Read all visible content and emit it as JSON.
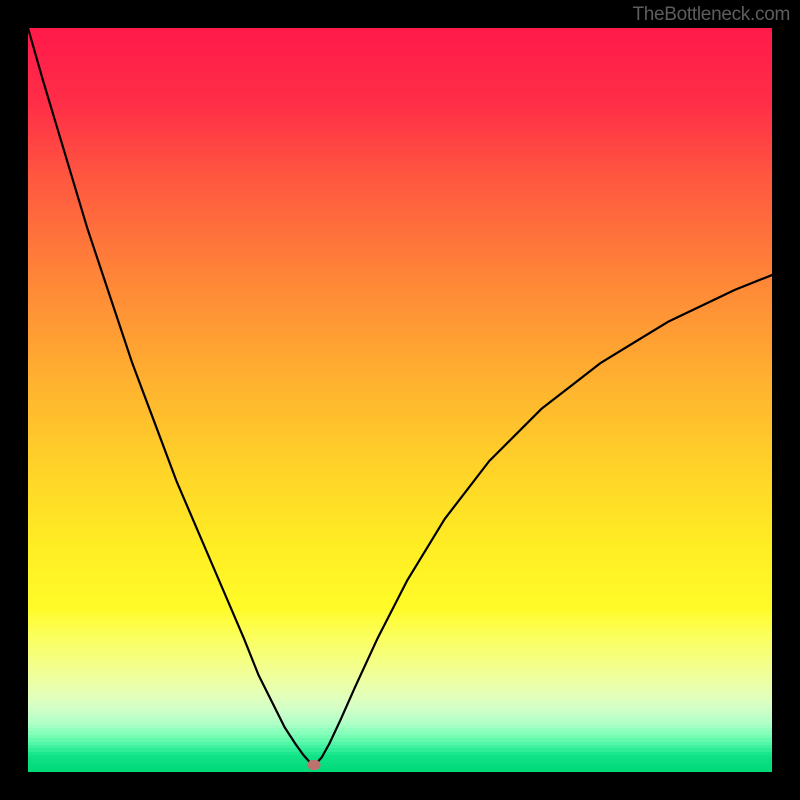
{
  "watermark": "TheBottleneck.com",
  "chart_data": {
    "type": "line",
    "title": "",
    "xlabel": "",
    "ylabel": "",
    "xlim": [
      0,
      100
    ],
    "ylim": [
      0,
      100
    ],
    "grid": false,
    "legend": false,
    "background": {
      "type": "vertical-gradient",
      "stops": [
        {
          "y": 0,
          "color": "#ff1a4a"
        },
        {
          "y": 10,
          "color": "#ff2e47"
        },
        {
          "y": 20,
          "color": "#ff5740"
        },
        {
          "y": 30,
          "color": "#ff7a3a"
        },
        {
          "y": 40,
          "color": "#ff9a34"
        },
        {
          "y": 50,
          "color": "#ffb92e"
        },
        {
          "y": 60,
          "color": "#ffd528"
        },
        {
          "y": 70,
          "color": "#ffee24"
        },
        {
          "y": 78,
          "color": "#fffb28"
        },
        {
          "y": 82,
          "color": "#fbff5e"
        },
        {
          "y": 86,
          "color": "#f3ff8c"
        },
        {
          "y": 89,
          "color": "#e9ffb0"
        },
        {
          "y": 91.5,
          "color": "#d5ffc8"
        },
        {
          "y": 93.5,
          "color": "#b2ffc8"
        },
        {
          "y": 95,
          "color": "#84ffba"
        },
        {
          "y": 96.3,
          "color": "#55f7a9"
        },
        {
          "y": 97.3,
          "color": "#2cec96"
        },
        {
          "y": 98,
          "color": "#11e388"
        },
        {
          "y": 100,
          "color": "#00da78"
        }
      ]
    },
    "series": [
      {
        "name": "bottleneck-curve",
        "x": [
          0,
          2,
          5,
          8,
          11,
          14,
          17,
          20,
          23,
          26,
          29,
          31,
          33,
          34.5,
          36,
          37,
          37.8,
          38.2,
          38.5,
          38.8,
          39.5,
          40.5,
          42,
          44,
          47,
          51,
          56,
          62,
          69,
          77,
          86,
          95,
          100
        ],
        "y": [
          0,
          7,
          17,
          27,
          36,
          45,
          53,
          61,
          68,
          75,
          82,
          87,
          91,
          94,
          96.3,
          97.7,
          98.6,
          98.9,
          99.0,
          98.8,
          98.0,
          96.2,
          93.0,
          88.5,
          82.0,
          74.2,
          66.0,
          58.2,
          51.2,
          45.0,
          39.5,
          35.2,
          33.2
        ]
      }
    ],
    "marker": {
      "x": 38.5,
      "y": 99.0,
      "color": "#bd726e"
    }
  }
}
